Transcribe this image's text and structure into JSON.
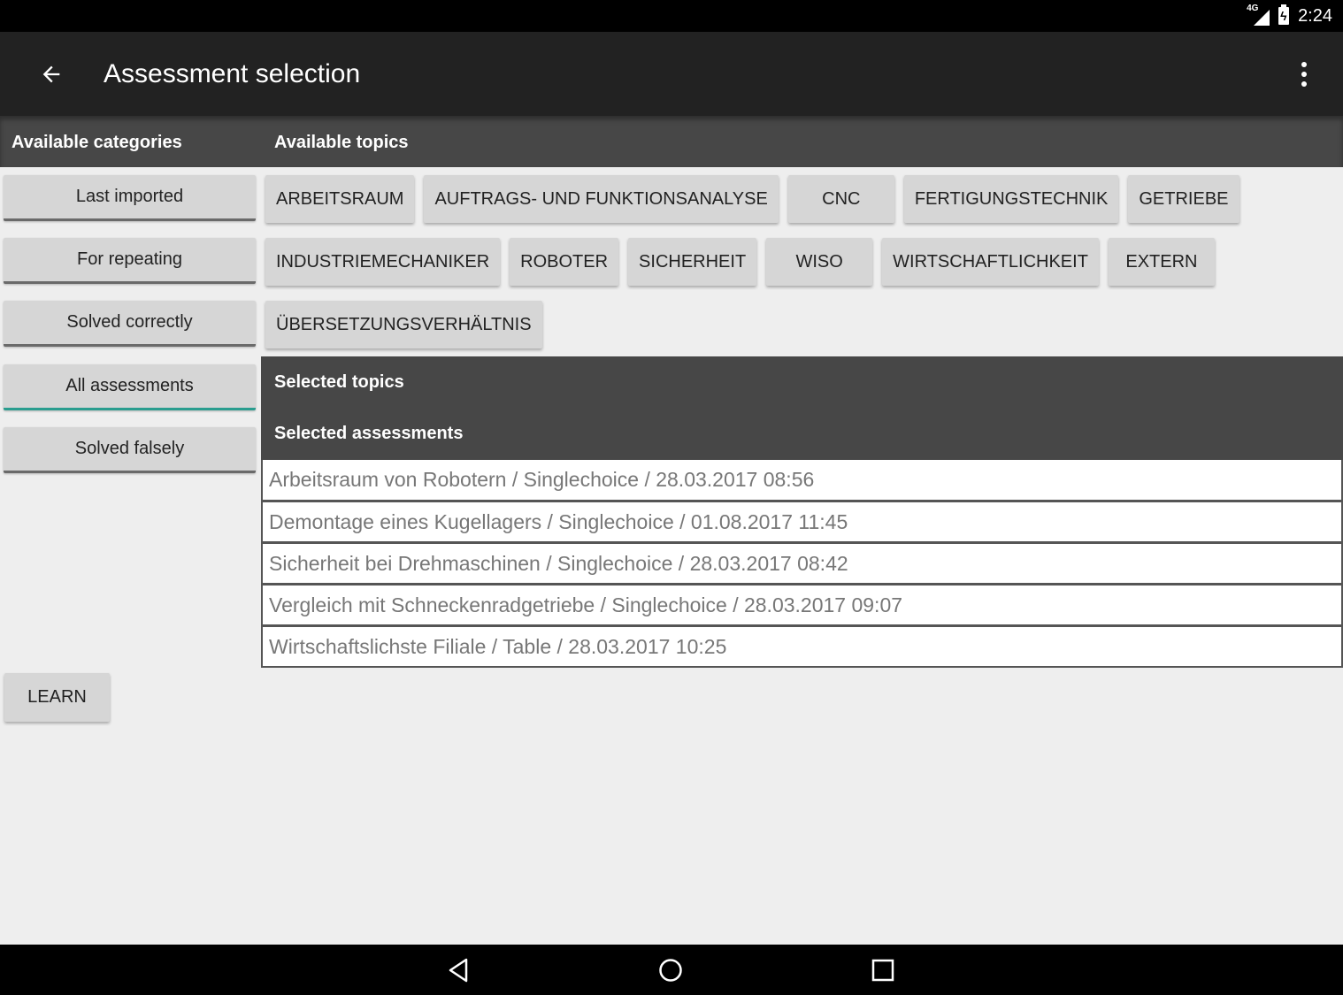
{
  "status_bar": {
    "network": "4G",
    "time": "2:24"
  },
  "app_bar": {
    "title": "Assessment selection"
  },
  "headers": {
    "categories": "Available categories",
    "topics": "Available topics"
  },
  "categories": [
    {
      "label": "Last imported",
      "selected": false
    },
    {
      "label": "For repeating",
      "selected": false
    },
    {
      "label": "Solved correctly",
      "selected": false
    },
    {
      "label": "All assessments",
      "selected": true
    },
    {
      "label": "Solved falsely",
      "selected": false
    }
  ],
  "topics": [
    [
      "ARBEITSRAUM",
      "AUFTRAGS- UND FUNKTIONSANALYSE",
      "CNC",
      "FERTIGUNGSTECHNIK",
      "GETRIEBE"
    ],
    [
      "INDUSTRIEMECHANIKER",
      "ROBOTER",
      "SICHERHEIT",
      "WISO",
      "WIRTSCHAFTLICHKEIT",
      "EXTERN"
    ],
    [
      "ÜBERSETZUNGSVERHÄLTNIS"
    ]
  ],
  "selected_panel": {
    "topics_label": "Selected topics",
    "assessments_label": "Selected assessments"
  },
  "assessments": [
    "Arbeitsraum von Robotern / Singlechoice / 28.03.2017 08:56",
    "Demontage eines Kugellagers / Singlechoice / 01.08.2017 11:45",
    "Sicherheit bei Drehmaschinen / Singlechoice / 28.03.2017 08:42",
    "Vergleich mit Schneckenradgetriebe / Singlechoice / 28.03.2017 09:07",
    "Wirtschaftslichste Filiale / Table / 28.03.2017 10:25"
  ],
  "learn_button": "LEARN",
  "colors": {
    "selected_accent": "#2a9d8f",
    "app_bar": "#222222",
    "header_strip": "#474747"
  }
}
